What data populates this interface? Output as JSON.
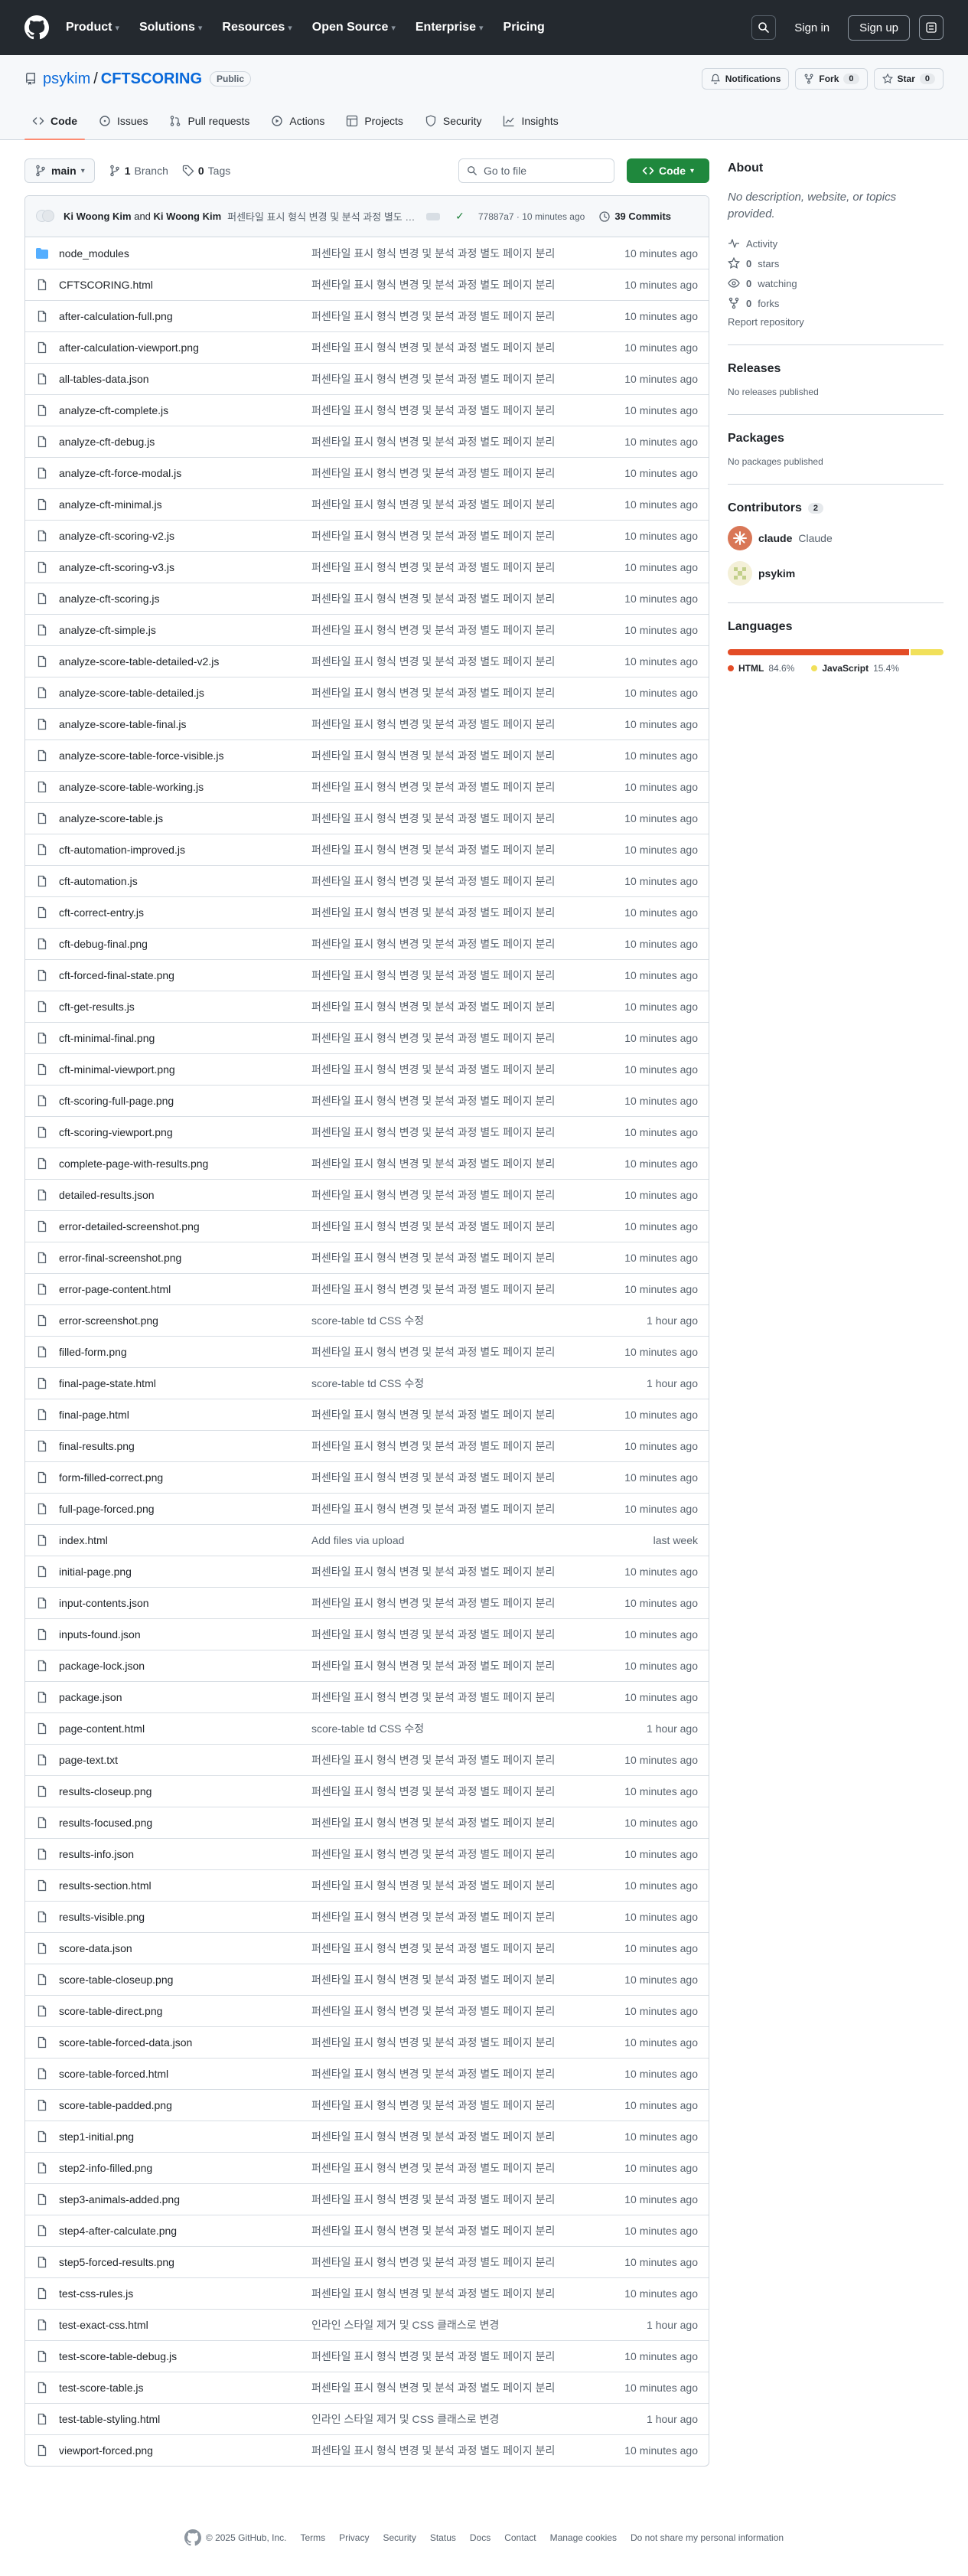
{
  "header": {
    "nav": [
      "Product",
      "Solutions",
      "Resources",
      "Open Source",
      "Enterprise",
      "Pricing"
    ],
    "sign_in": "Sign in",
    "sign_up": "Sign up"
  },
  "repo": {
    "owner": "psykim",
    "sep": "/",
    "name": "CFTSCORING",
    "visibility": "Public",
    "notifications": "Notifications",
    "fork": "Fork",
    "fork_count": "0",
    "star": "Star",
    "star_count": "0",
    "tabs": [
      "Code",
      "Issues",
      "Pull requests",
      "Actions",
      "Projects",
      "Security",
      "Insights"
    ]
  },
  "toolbar": {
    "branch": "main",
    "branch_count": "1",
    "branch_label": "Branch",
    "tag_count": "0",
    "tag_label": "Tags",
    "go_to_file": "Go to file",
    "code_button": "Code"
  },
  "commit": {
    "author1": "Ki Woong Kim",
    "and": "and",
    "author2": "Ki Woong Kim",
    "message": "퍼센타일 표시 형식 변경 및 분석 과정 별도 페이지 분리",
    "hash_time": "77887a7 · 10 minutes ago",
    "commits": "39 Commits"
  },
  "files": [
    {
      "name": "node_modules",
      "type": "folder",
      "msg": "퍼센타일 표시 형식 변경 및 분석 과정 별도 페이지 분리",
      "time": "10 minutes ago"
    },
    {
      "name": "CFTSCORING.html",
      "type": "file",
      "msg": "퍼센타일 표시 형식 변경 및 분석 과정 별도 페이지 분리",
      "time": "10 minutes ago"
    },
    {
      "name": "after-calculation-full.png",
      "type": "file",
      "msg": "퍼센타일 표시 형식 변경 및 분석 과정 별도 페이지 분리",
      "time": "10 minutes ago"
    },
    {
      "name": "after-calculation-viewport.png",
      "type": "file",
      "msg": "퍼센타일 표시 형식 변경 및 분석 과정 별도 페이지 분리",
      "time": "10 minutes ago"
    },
    {
      "name": "all-tables-data.json",
      "type": "file",
      "msg": "퍼센타일 표시 형식 변경 및 분석 과정 별도 페이지 분리",
      "time": "10 minutes ago"
    },
    {
      "name": "analyze-cft-complete.js",
      "type": "file",
      "msg": "퍼센타일 표시 형식 변경 및 분석 과정 별도 페이지 분리",
      "time": "10 minutes ago"
    },
    {
      "name": "analyze-cft-debug.js",
      "type": "file",
      "msg": "퍼센타일 표시 형식 변경 및 분석 과정 별도 페이지 분리",
      "time": "10 minutes ago"
    },
    {
      "name": "analyze-cft-force-modal.js",
      "type": "file",
      "msg": "퍼센타일 표시 형식 변경 및 분석 과정 별도 페이지 분리",
      "time": "10 minutes ago"
    },
    {
      "name": "analyze-cft-minimal.js",
      "type": "file",
      "msg": "퍼센타일 표시 형식 변경 및 분석 과정 별도 페이지 분리",
      "time": "10 minutes ago"
    },
    {
      "name": "analyze-cft-scoring-v2.js",
      "type": "file",
      "msg": "퍼센타일 표시 형식 변경 및 분석 과정 별도 페이지 분리",
      "time": "10 minutes ago"
    },
    {
      "name": "analyze-cft-scoring-v3.js",
      "type": "file",
      "msg": "퍼센타일 표시 형식 변경 및 분석 과정 별도 페이지 분리",
      "time": "10 minutes ago"
    },
    {
      "name": "analyze-cft-scoring.js",
      "type": "file",
      "msg": "퍼센타일 표시 형식 변경 및 분석 과정 별도 페이지 분리",
      "time": "10 minutes ago"
    },
    {
      "name": "analyze-cft-simple.js",
      "type": "file",
      "msg": "퍼센타일 표시 형식 변경 및 분석 과정 별도 페이지 분리",
      "time": "10 minutes ago"
    },
    {
      "name": "analyze-score-table-detailed-v2.js",
      "type": "file",
      "msg": "퍼센타일 표시 형식 변경 및 분석 과정 별도 페이지 분리",
      "time": "10 minutes ago"
    },
    {
      "name": "analyze-score-table-detailed.js",
      "type": "file",
      "msg": "퍼센타일 표시 형식 변경 및 분석 과정 별도 페이지 분리",
      "time": "10 minutes ago"
    },
    {
      "name": "analyze-score-table-final.js",
      "type": "file",
      "msg": "퍼센타일 표시 형식 변경 및 분석 과정 별도 페이지 분리",
      "time": "10 minutes ago"
    },
    {
      "name": "analyze-score-table-force-visible.js",
      "type": "file",
      "msg": "퍼센타일 표시 형식 변경 및 분석 과정 별도 페이지 분리",
      "time": "10 minutes ago"
    },
    {
      "name": "analyze-score-table-working.js",
      "type": "file",
      "msg": "퍼센타일 표시 형식 변경 및 분석 과정 별도 페이지 분리",
      "time": "10 minutes ago"
    },
    {
      "name": "analyze-score-table.js",
      "type": "file",
      "msg": "퍼센타일 표시 형식 변경 및 분석 과정 별도 페이지 분리",
      "time": "10 minutes ago"
    },
    {
      "name": "cft-automation-improved.js",
      "type": "file",
      "msg": "퍼센타일 표시 형식 변경 및 분석 과정 별도 페이지 분리",
      "time": "10 minutes ago"
    },
    {
      "name": "cft-automation.js",
      "type": "file",
      "msg": "퍼센타일 표시 형식 변경 및 분석 과정 별도 페이지 분리",
      "time": "10 minutes ago"
    },
    {
      "name": "cft-correct-entry.js",
      "type": "file",
      "msg": "퍼센타일 표시 형식 변경 및 분석 과정 별도 페이지 분리",
      "time": "10 minutes ago"
    },
    {
      "name": "cft-debug-final.png",
      "type": "file",
      "msg": "퍼센타일 표시 형식 변경 및 분석 과정 별도 페이지 분리",
      "time": "10 minutes ago"
    },
    {
      "name": "cft-forced-final-state.png",
      "type": "file",
      "msg": "퍼센타일 표시 형식 변경 및 분석 과정 별도 페이지 분리",
      "time": "10 minutes ago"
    },
    {
      "name": "cft-get-results.js",
      "type": "file",
      "msg": "퍼센타일 표시 형식 변경 및 분석 과정 별도 페이지 분리",
      "time": "10 minutes ago"
    },
    {
      "name": "cft-minimal-final.png",
      "type": "file",
      "msg": "퍼센타일 표시 형식 변경 및 분석 과정 별도 페이지 분리",
      "time": "10 minutes ago"
    },
    {
      "name": "cft-minimal-viewport.png",
      "type": "file",
      "msg": "퍼센타일 표시 형식 변경 및 분석 과정 별도 페이지 분리",
      "time": "10 minutes ago"
    },
    {
      "name": "cft-scoring-full-page.png",
      "type": "file",
      "msg": "퍼센타일 표시 형식 변경 및 분석 과정 별도 페이지 분리",
      "time": "10 minutes ago"
    },
    {
      "name": "cft-scoring-viewport.png",
      "type": "file",
      "msg": "퍼센타일 표시 형식 변경 및 분석 과정 별도 페이지 분리",
      "time": "10 minutes ago"
    },
    {
      "name": "complete-page-with-results.png",
      "type": "file",
      "msg": "퍼센타일 표시 형식 변경 및 분석 과정 별도 페이지 분리",
      "time": "10 minutes ago"
    },
    {
      "name": "detailed-results.json",
      "type": "file",
      "msg": "퍼센타일 표시 형식 변경 및 분석 과정 별도 페이지 분리",
      "time": "10 minutes ago"
    },
    {
      "name": "error-detailed-screenshot.png",
      "type": "file",
      "msg": "퍼센타일 표시 형식 변경 및 분석 과정 별도 페이지 분리",
      "time": "10 minutes ago"
    },
    {
      "name": "error-final-screenshot.png",
      "type": "file",
      "msg": "퍼센타일 표시 형식 변경 및 분석 과정 별도 페이지 분리",
      "time": "10 minutes ago"
    },
    {
      "name": "error-page-content.html",
      "type": "file",
      "msg": "퍼센타일 표시 형식 변경 및 분석 과정 별도 페이지 분리",
      "time": "10 minutes ago"
    },
    {
      "name": "error-screenshot.png",
      "type": "file",
      "msg": "score-table td CSS 수정",
      "time": "1 hour ago"
    },
    {
      "name": "filled-form.png",
      "type": "file",
      "msg": "퍼센타일 표시 형식 변경 및 분석 과정 별도 페이지 분리",
      "time": "10 minutes ago"
    },
    {
      "name": "final-page-state.html",
      "type": "file",
      "msg": "score-table td CSS 수정",
      "time": "1 hour ago"
    },
    {
      "name": "final-page.html",
      "type": "file",
      "msg": "퍼센타일 표시 형식 변경 및 분석 과정 별도 페이지 분리",
      "time": "10 minutes ago"
    },
    {
      "name": "final-results.png",
      "type": "file",
      "msg": "퍼센타일 표시 형식 변경 및 분석 과정 별도 페이지 분리",
      "time": "10 minutes ago"
    },
    {
      "name": "form-filled-correct.png",
      "type": "file",
      "msg": "퍼센타일 표시 형식 변경 및 분석 과정 별도 페이지 분리",
      "time": "10 minutes ago"
    },
    {
      "name": "full-page-forced.png",
      "type": "file",
      "msg": "퍼센타일 표시 형식 변경 및 분석 과정 별도 페이지 분리",
      "time": "10 minutes ago"
    },
    {
      "name": "index.html",
      "type": "file",
      "msg": "Add files via upload",
      "time": "last week"
    },
    {
      "name": "initial-page.png",
      "type": "file",
      "msg": "퍼센타일 표시 형식 변경 및 분석 과정 별도 페이지 분리",
      "time": "10 minutes ago"
    },
    {
      "name": "input-contents.json",
      "type": "file",
      "msg": "퍼센타일 표시 형식 변경 및 분석 과정 별도 페이지 분리",
      "time": "10 minutes ago"
    },
    {
      "name": "inputs-found.json",
      "type": "file",
      "msg": "퍼센타일 표시 형식 변경 및 분석 과정 별도 페이지 분리",
      "time": "10 minutes ago"
    },
    {
      "name": "package-lock.json",
      "type": "file",
      "msg": "퍼센타일 표시 형식 변경 및 분석 과정 별도 페이지 분리",
      "time": "10 minutes ago"
    },
    {
      "name": "package.json",
      "type": "file",
      "msg": "퍼센타일 표시 형식 변경 및 분석 과정 별도 페이지 분리",
      "time": "10 minutes ago"
    },
    {
      "name": "page-content.html",
      "type": "file",
      "msg": "score-table td CSS 수정",
      "time": "1 hour ago"
    },
    {
      "name": "page-text.txt",
      "type": "file",
      "msg": "퍼센타일 표시 형식 변경 및 분석 과정 별도 페이지 분리",
      "time": "10 minutes ago"
    },
    {
      "name": "results-closeup.png",
      "type": "file",
      "msg": "퍼센타일 표시 형식 변경 및 분석 과정 별도 페이지 분리",
      "time": "10 minutes ago"
    },
    {
      "name": "results-focused.png",
      "type": "file",
      "msg": "퍼센타일 표시 형식 변경 및 분석 과정 별도 페이지 분리",
      "time": "10 minutes ago"
    },
    {
      "name": "results-info.json",
      "type": "file",
      "msg": "퍼센타일 표시 형식 변경 및 분석 과정 별도 페이지 분리",
      "time": "10 minutes ago"
    },
    {
      "name": "results-section.html",
      "type": "file",
      "msg": "퍼센타일 표시 형식 변경 및 분석 과정 별도 페이지 분리",
      "time": "10 minutes ago"
    },
    {
      "name": "results-visible.png",
      "type": "file",
      "msg": "퍼센타일 표시 형식 변경 및 분석 과정 별도 페이지 분리",
      "time": "10 minutes ago"
    },
    {
      "name": "score-data.json",
      "type": "file",
      "msg": "퍼센타일 표시 형식 변경 및 분석 과정 별도 페이지 분리",
      "time": "10 minutes ago"
    },
    {
      "name": "score-table-closeup.png",
      "type": "file",
      "msg": "퍼센타일 표시 형식 변경 및 분석 과정 별도 페이지 분리",
      "time": "10 minutes ago"
    },
    {
      "name": "score-table-direct.png",
      "type": "file",
      "msg": "퍼센타일 표시 형식 변경 및 분석 과정 별도 페이지 분리",
      "time": "10 minutes ago"
    },
    {
      "name": "score-table-forced-data.json",
      "type": "file",
      "msg": "퍼센타일 표시 형식 변경 및 분석 과정 별도 페이지 분리",
      "time": "10 minutes ago"
    },
    {
      "name": "score-table-forced.html",
      "type": "file",
      "msg": "퍼센타일 표시 형식 변경 및 분석 과정 별도 페이지 분리",
      "time": "10 minutes ago"
    },
    {
      "name": "score-table-padded.png",
      "type": "file",
      "msg": "퍼센타일 표시 형식 변경 및 분석 과정 별도 페이지 분리",
      "time": "10 minutes ago"
    },
    {
      "name": "step1-initial.png",
      "type": "file",
      "msg": "퍼센타일 표시 형식 변경 및 분석 과정 별도 페이지 분리",
      "time": "10 minutes ago"
    },
    {
      "name": "step2-info-filled.png",
      "type": "file",
      "msg": "퍼센타일 표시 형식 변경 및 분석 과정 별도 페이지 분리",
      "time": "10 minutes ago"
    },
    {
      "name": "step3-animals-added.png",
      "type": "file",
      "msg": "퍼센타일 표시 형식 변경 및 분석 과정 별도 페이지 분리",
      "time": "10 minutes ago"
    },
    {
      "name": "step4-after-calculate.png",
      "type": "file",
      "msg": "퍼센타일 표시 형식 변경 및 분석 과정 별도 페이지 분리",
      "time": "10 minutes ago"
    },
    {
      "name": "step5-forced-results.png",
      "type": "file",
      "msg": "퍼센타일 표시 형식 변경 및 분석 과정 별도 페이지 분리",
      "time": "10 minutes ago"
    },
    {
      "name": "test-css-rules.js",
      "type": "file",
      "msg": "퍼센타일 표시 형식 변경 및 분석 과정 별도 페이지 분리",
      "time": "10 minutes ago"
    },
    {
      "name": "test-exact-css.html",
      "type": "file",
      "msg": "인라인 스타일 제거 및 CSS 클래스로 변경",
      "time": "1 hour ago"
    },
    {
      "name": "test-score-table-debug.js",
      "type": "file",
      "msg": "퍼센타일 표시 형식 변경 및 분석 과정 별도 페이지 분리",
      "time": "10 minutes ago"
    },
    {
      "name": "test-score-table.js",
      "type": "file",
      "msg": "퍼센타일 표시 형식 변경 및 분석 과정 별도 페이지 분리",
      "time": "10 minutes ago"
    },
    {
      "name": "test-table-styling.html",
      "type": "file",
      "msg": "인라인 스타일 제거 및 CSS 클래스로 변경",
      "time": "1 hour ago"
    },
    {
      "name": "viewport-forced.png",
      "type": "file",
      "msg": "퍼센타일 표시 형식 변경 및 분석 과정 별도 페이지 분리",
      "time": "10 minutes ago"
    }
  ],
  "about": {
    "title": "About",
    "description": "No description, website, or topics provided.",
    "activity": "Activity",
    "stars_count": "0",
    "stars": "stars",
    "watching_count": "0",
    "watching": "watching",
    "forks_count": "0",
    "forks": "forks",
    "report": "Report repository"
  },
  "releases": {
    "title": "Releases",
    "none": "No releases published"
  },
  "packages": {
    "title": "Packages",
    "none": "No packages published"
  },
  "contributors": {
    "title": "Contributors",
    "count": "2",
    "list": [
      {
        "login": "claude",
        "name": "Claude"
      },
      {
        "login": "psykim",
        "name": ""
      }
    ]
  },
  "languages": {
    "title": "Languages",
    "list": [
      {
        "name": "HTML",
        "pct": "84.6%",
        "value": 84.6,
        "color": "#e34c26"
      },
      {
        "name": "JavaScript",
        "pct": "15.4%",
        "value": 15.4,
        "color": "#f1e05a"
      }
    ]
  },
  "footer": {
    "copyright": "© 2025 GitHub, Inc.",
    "links": [
      "Terms",
      "Privacy",
      "Security",
      "Status",
      "Docs",
      "Contact",
      "Manage cookies",
      "Do not share my personal information"
    ]
  }
}
